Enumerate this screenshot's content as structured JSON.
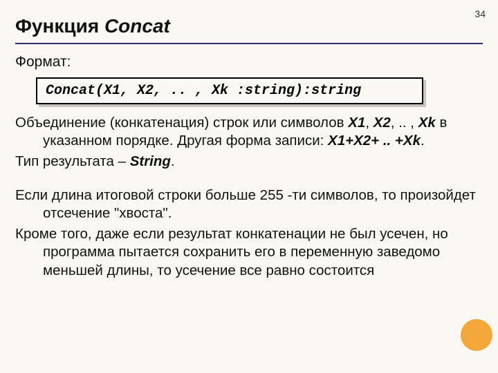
{
  "page_number": "34",
  "title_prefix": "Функция ",
  "title_fn": "Concat",
  "format_label": "Формат:",
  "code": "Concat(X1, X2, .. , Xk :string):string",
  "p1_a": "Объединение (конкатенация) строк или символов ",
  "p1_x1": "X1",
  "p1_comma1": ", ",
  "p1_x2": "X2",
  "p1_b": ", .. , ",
  "p1_xk": "Xk",
  "p1_c": " в указанном порядке. Другая форма записи: ",
  "p1_expr": "X1+X2+ .. +Xk",
  "p1_d": ".",
  "p2_a": "Тип результата – ",
  "p2_str": "String",
  "p2_b": ".",
  "p3": "Если длина итоговой строки больше 255 -ти символов, то произойдет отсечение \"хвоста\".",
  "p4": "Кроме того, даже если результат конкатенации не был усечен, но программа пытается сохранить его в переменную заведомо меньшей длины, то усечение все равно состоится"
}
